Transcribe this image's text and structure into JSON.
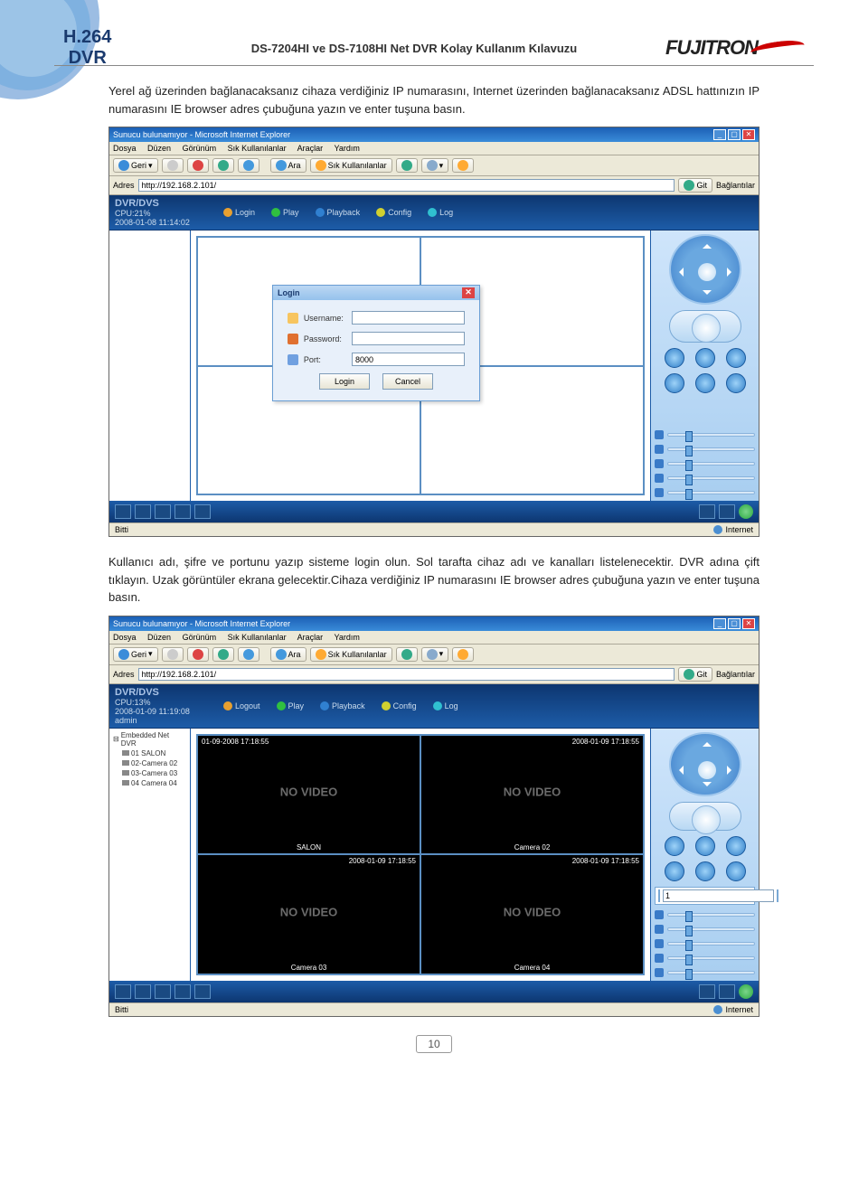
{
  "header": {
    "doc_title": "DS-7204HI ve DS-7108HI Net DVR  Kolay Kullanım Kılavuzu",
    "badge_line1": "H.264",
    "badge_line2": "DVR",
    "logo": "FUJITRON"
  },
  "para1": "Yerel ağ üzerinden bağlanacaksanız cihaza verdiğiniz IP numarasını, Internet üzerinden bağlanacaksanız ADSL hattınızın IP numarasını IE browser adres çubuğuna yazın ve enter tuşuna basın.",
  "para2": "Kullanıcı adı, şifre ve portunu yazıp sisteme login olun. Sol tarafta cihaz adı ve kanalları listelenecektir. DVR adına çift tıklayın. Uzak görüntüler ekrana gelecektir.Cihaza verdiğiniz IP numarasını IE browser adres çubuğuna yazın ve enter tuşuna basın.",
  "shot1": {
    "ie_title": "Sunucu bulunamıyor - Microsoft Internet Explorer",
    "menu": {
      "file": "Dosya",
      "edit": "Düzen",
      "view": "Görünüm",
      "fav": "Sık Kullanılanlar",
      "tools": "Araçlar",
      "help": "Yardım"
    },
    "toolbar": {
      "back": "Geri",
      "ara": "Ara",
      "fav": "Sık Kullanılanlar"
    },
    "addr_label": "Adres",
    "addr_value": "http://192.168.2.101/",
    "go": "Git",
    "links": "Bağlantılar",
    "dvr_title": "DVR/DVS",
    "cpu": "CPU:21%",
    "ts": "2008-01-08 11:14:02",
    "tabs": {
      "login": "Login",
      "play": "Play",
      "playback": "Playback",
      "config": "Config",
      "log": "Log"
    },
    "login_box": {
      "title": "Login",
      "user": "Username:",
      "pass": "Password:",
      "port": "Port:",
      "port_val": "8000",
      "ok": "Login",
      "cancel": "Cancel"
    },
    "status_left": "Bitti",
    "status_right": "Internet"
  },
  "shot2": {
    "ie_title": "Sunucu bulunamıyor - Microsoft Internet Explorer",
    "menu": {
      "file": "Dosya",
      "edit": "Düzen",
      "view": "Görünüm",
      "fav": "Sık Kullanılanlar",
      "tools": "Araçlar",
      "help": "Yardım"
    },
    "toolbar": {
      "back": "Geri",
      "ara": "Ara",
      "fav": "Sık Kullanılanlar"
    },
    "addr_label": "Adres",
    "addr_value": "http://192.168.2.101/",
    "go": "Git",
    "links": "Bağlantılar",
    "dvr_title": "DVR/DVS",
    "cpu": "CPU:13%",
    "ts": "2008-01-09 11:19:08",
    "user": "admin",
    "tabs": {
      "logout": "Logout",
      "play": "Play",
      "playback": "Playback",
      "config": "Config",
      "log": "Log"
    },
    "tree": {
      "root": "Embedded Net DVR",
      "ch1": "01 SALON",
      "ch2": "02-Camera 02",
      "ch3": "03-Camera 03",
      "ch4": "04 Camera 04"
    },
    "cells": {
      "c1_top": "01-09-2008 17:18:55",
      "c1_name": "SALON",
      "c2_top": "2008-01-09 17:18:55",
      "c2_name": "Camera 02",
      "c3_top": "2008-01-09 17:18:55",
      "c3_name": "Camera 03",
      "c4_top": "2008-01-09 17:18:55",
      "c4_name": "Camera 04",
      "novideo": "NO VIDEO"
    },
    "preset_val": "1",
    "status_left": "Bitti",
    "status_right": "Internet"
  },
  "page_num": "10"
}
